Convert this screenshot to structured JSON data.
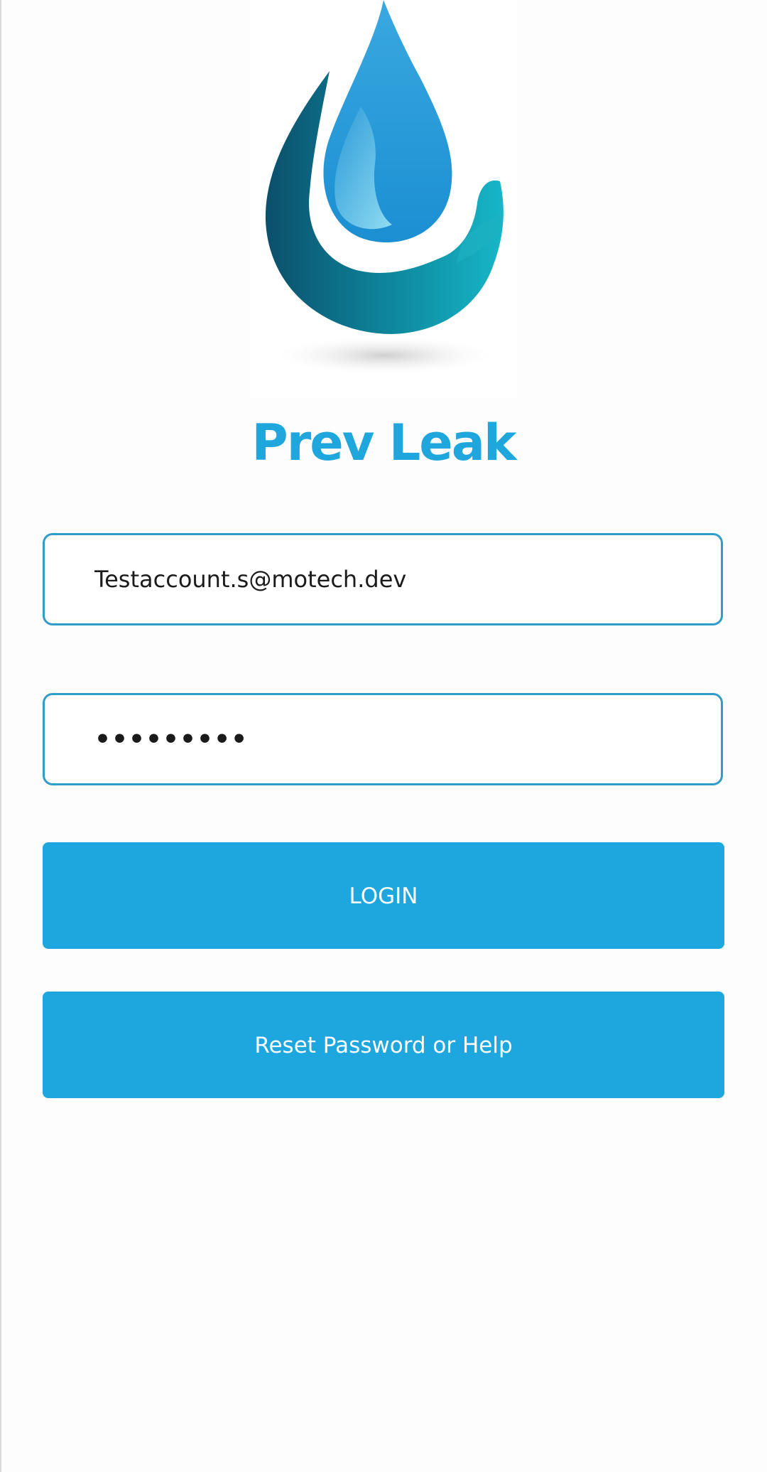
{
  "app": {
    "title": "Prev Leak"
  },
  "logo": {
    "icon": "water-drop-hand-icon"
  },
  "form": {
    "email_value": "Testaccount.s@motech.dev",
    "password_value": "•••••••••"
  },
  "buttons": {
    "login_label": "LOGIN",
    "reset_label": "Reset Password or Help"
  },
  "colors": {
    "accent": "#1ea6df",
    "field_border": "#2f9dc8",
    "title": "#1ea6dd"
  }
}
